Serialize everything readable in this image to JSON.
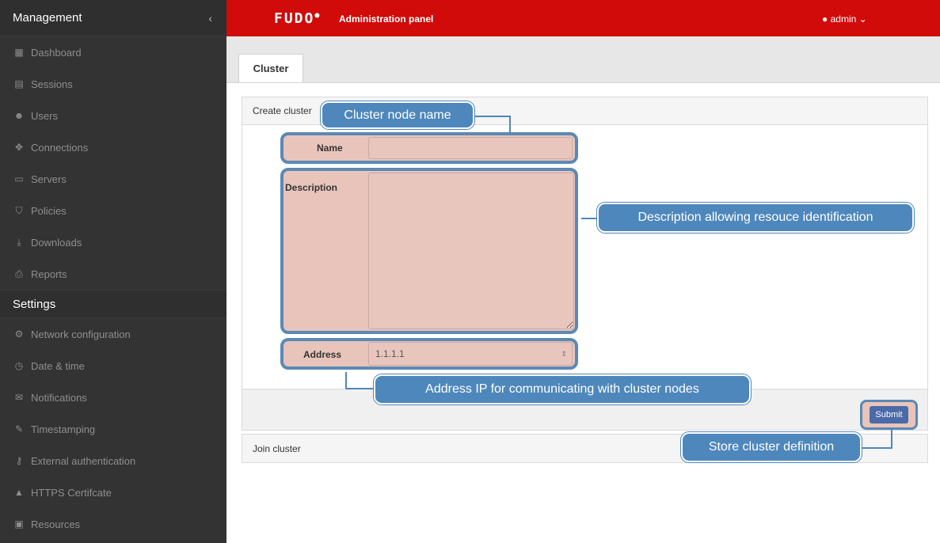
{
  "sidebar": {
    "title": "Management",
    "collapse_icon": "chevron-left-icon",
    "management_items": [
      {
        "label": "Dashboard",
        "icon": "dashboard-icon"
      },
      {
        "label": "Sessions",
        "icon": "film-icon"
      },
      {
        "label": "Users",
        "icon": "users-icon"
      },
      {
        "label": "Connections",
        "icon": "connections-icon"
      },
      {
        "label": "Servers",
        "icon": "server-icon"
      },
      {
        "label": "Policies",
        "icon": "shield-icon"
      },
      {
        "label": "Downloads",
        "icon": "download-icon"
      },
      {
        "label": "Reports",
        "icon": "print-icon"
      }
    ],
    "settings_title": "Settings",
    "settings_items": [
      {
        "label": "Network configuration",
        "icon": "gears-icon"
      },
      {
        "label": "Date & time",
        "icon": "clock-icon"
      },
      {
        "label": "Notifications",
        "icon": "envelope-icon"
      },
      {
        "label": "Timestamping",
        "icon": "edit-icon"
      },
      {
        "label": "External authentication",
        "icon": "key-icon"
      },
      {
        "label": "HTTPS Certifcate",
        "icon": "lock-icon"
      },
      {
        "label": "Resources",
        "icon": "image-icon"
      }
    ]
  },
  "topbar": {
    "logo": "FUDO",
    "panel_title": "Administration panel",
    "user": "admin",
    "user_icon": "user-icon"
  },
  "tabs": [
    {
      "label": "Cluster"
    }
  ],
  "create_panel": {
    "title": "Create cluster",
    "name_label": "Name",
    "name_value": "",
    "description_label": "Description",
    "description_value": "",
    "address_label": "Address",
    "address_value": "1.1.1.1",
    "submit_label": "Submit"
  },
  "join_panel": {
    "title": "Join cluster"
  },
  "callouts": {
    "name": "Cluster node name",
    "description": "Description allowing resouce identification",
    "address": "Address IP for communicating with cluster nodes",
    "submit": "Store cluster definition"
  },
  "colors": {
    "topbar": "#d10a0a",
    "sidebar": "#333333",
    "callout": "#4e87bb",
    "highlight": "#e8c4bb",
    "submit_button": "#4a6aa8"
  }
}
